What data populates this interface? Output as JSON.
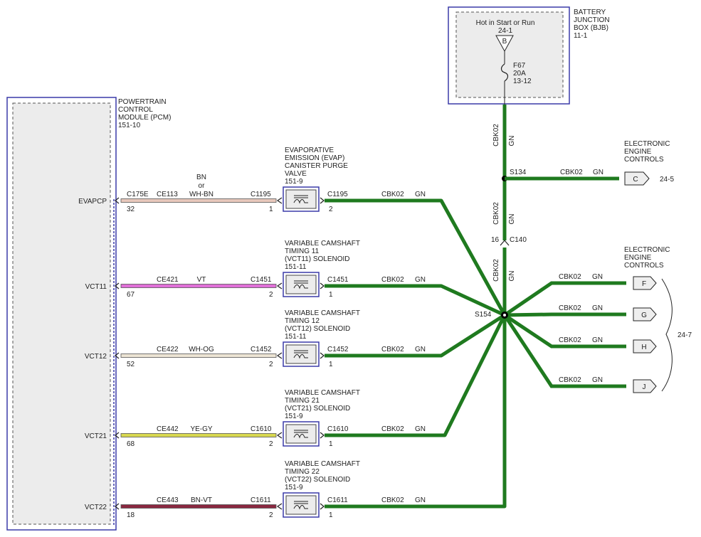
{
  "pcm": {
    "title_lines": [
      "POWERTRAIN",
      "CONTROL",
      "MODULE (PCM)",
      "151-10"
    ]
  },
  "bjb": {
    "title_lines": [
      "BATTERY",
      "JUNCTION",
      "BOX (BJB)",
      "11-1"
    ],
    "hot_label": "Hot in Start or Run",
    "hot_ref": "24-1",
    "pin": "B",
    "fuse_lines": [
      "F67",
      "20A",
      "13-12"
    ]
  },
  "feed": {
    "circuit": "CBK02",
    "color": "GN",
    "splice_s134": "S134",
    "splice_s154": "S154",
    "c140_pin": "16",
    "c140_name": "C140"
  },
  "eec_top": {
    "title_lines": [
      "ELECTRONIC",
      "ENGINE",
      "CONTROLS"
    ],
    "circuit": "CBK02",
    "color": "GN",
    "pin": "C",
    "ref": "24-5"
  },
  "eec_right": {
    "title_lines": [
      "ELECTRONIC",
      "ENGINE",
      "CONTROLS"
    ],
    "ref": "24-7",
    "branches": [
      {
        "circuit": "CBK02",
        "color": "GN",
        "pin": "F"
      },
      {
        "circuit": "CBK02",
        "color": "GN",
        "pin": "G"
      },
      {
        "circuit": "CBK02",
        "color": "GN",
        "pin": "H"
      },
      {
        "circuit": "CBK02",
        "color": "GN",
        "pin": "J"
      }
    ]
  },
  "rows": [
    {
      "pcm_pin_name": "EVAPCP",
      "pcm_conn": "C175E",
      "pcm_pin": "32",
      "circuit": "CE113",
      "wire_color_label_lines": [
        "BN",
        "or",
        "WH-BN"
      ],
      "wire_hex": "#e8c8bc",
      "dev_conn": "C1195",
      "dev_pin_left": "1",
      "dev_pin_right": "2",
      "device_lines": [
        "EVAPORATIVE",
        "EMISSION (EVAP)",
        "CANISTER PURGE",
        "VALVE",
        "151-9"
      ],
      "out_circuit": "CBK02",
      "out_color": "GN"
    },
    {
      "pcm_pin_name": "VCT11",
      "pcm_conn": "",
      "pcm_pin": "67",
      "circuit": "CE421",
      "wire_color_label_lines": [
        "VT"
      ],
      "wire_hex": "#e070d8",
      "dev_conn": "C1451",
      "dev_pin_left": "2",
      "dev_pin_right": "1",
      "device_lines": [
        "VARIABLE CAMSHAFT",
        "TIMING 11",
        "(VCT11) SOLENOID",
        "151-11"
      ],
      "out_circuit": "CBK02",
      "out_color": "GN"
    },
    {
      "pcm_pin_name": "VCT12",
      "pcm_conn": "",
      "pcm_pin": "52",
      "circuit": "CE422",
      "wire_color_label_lines": [
        "WH-OG"
      ],
      "wire_hex": "#ece4d4",
      "dev_conn": "C1452",
      "dev_pin_left": "2",
      "dev_pin_right": "1",
      "device_lines": [
        "VARIABLE CAMSHAFT",
        "TIMING 12",
        "(VCT12) SOLENOID",
        "151-11"
      ],
      "out_circuit": "CBK02",
      "out_color": "GN"
    },
    {
      "pcm_pin_name": "VCT21",
      "pcm_conn": "",
      "pcm_pin": "68",
      "circuit": "CE442",
      "wire_color_label_lines": [
        "YE-GY"
      ],
      "wire_hex": "#d8d850",
      "dev_conn": "C1610",
      "dev_pin_left": "2",
      "dev_pin_right": "1",
      "device_lines": [
        "VARIABLE CAMSHAFT",
        "TIMING 21",
        "(VCT21) SOLENOID",
        "151-9"
      ],
      "out_circuit": "CBK02",
      "out_color": "GN"
    },
    {
      "pcm_pin_name": "VCT22",
      "pcm_conn": "",
      "pcm_pin": "18",
      "circuit": "CE443",
      "wire_color_label_lines": [
        "BN-VT"
      ],
      "wire_hex": "#8a2840",
      "dev_conn": "C1611",
      "dev_pin_left": "2",
      "dev_pin_right": "1",
      "device_lines": [
        "VARIABLE CAMSHAFT",
        "TIMING 22",
        "(VCT22) SOLENOID",
        "151-9"
      ],
      "out_circuit": "CBK02",
      "out_color": "GN"
    }
  ]
}
